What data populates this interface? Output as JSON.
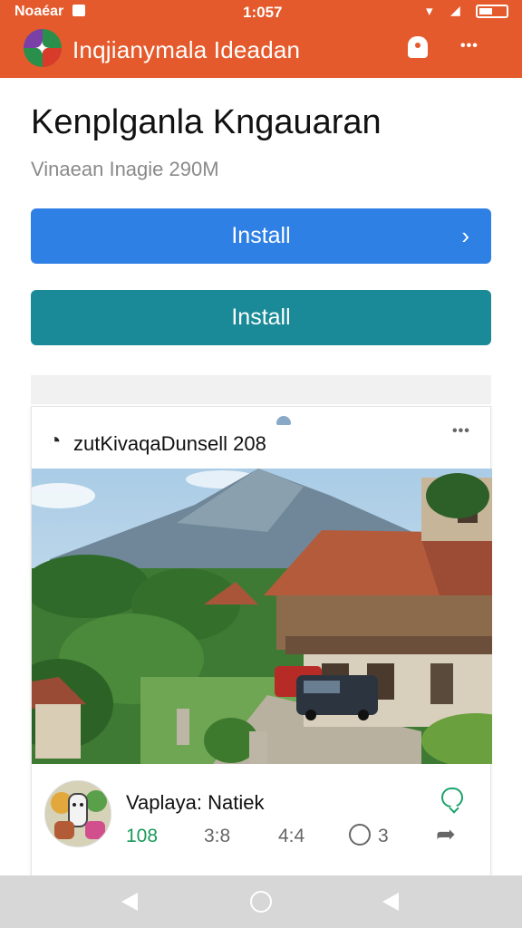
{
  "status_bar": {
    "carrier": "Noaéar",
    "time": "1:057"
  },
  "toolbar": {
    "title": "Inqjianymala Ideadan",
    "more_label": "•••"
  },
  "header": {
    "title": "Kenplganla Kngauaran",
    "subtitle": "Vinaean Inagie 290M"
  },
  "buttons": {
    "install_primary": "Install",
    "install_secondary": "Install",
    "chevron": "›"
  },
  "post": {
    "title": "zutKivaqaDunsell  208",
    "author": "Vaplaya: Natiek",
    "stats": {
      "likes": "108",
      "views": "3:8",
      "shares": "4:4",
      "comments": "3"
    }
  },
  "colors": {
    "app_bar": "#e45a2c",
    "install_primary": "#2f80e4",
    "install_secondary": "#1b8a98",
    "accent_green": "#1a9a5a"
  },
  "icons": {
    "logo": "app-logo",
    "notification": "bell-icon",
    "overflow": "more-icon",
    "post_type": "timer-icon",
    "follow": "chat-bubble-icon",
    "comment": "comment-icon",
    "share": "share-icon"
  }
}
